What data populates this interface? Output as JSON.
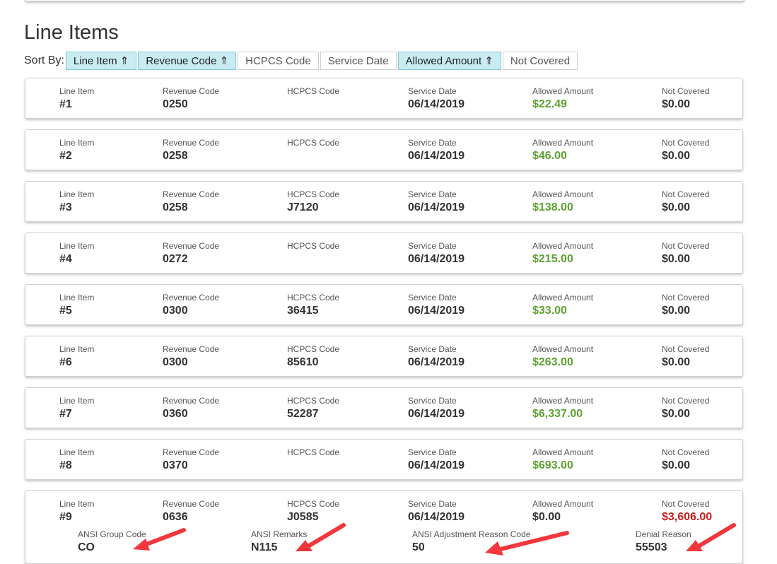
{
  "section_title": "Line Items",
  "sort": {
    "label": "Sort By:",
    "buttons": [
      {
        "label": "Line Item ⇑",
        "active": true
      },
      {
        "label": "Revenue Code ⇑",
        "active": true
      },
      {
        "label": "HCPCS Code",
        "active": false
      },
      {
        "label": "Service Date",
        "active": false
      },
      {
        "label": "Allowed Amount ⇑",
        "active": true
      },
      {
        "label": "Not Covered",
        "active": false
      }
    ]
  },
  "columns": {
    "line_item": "Line Item",
    "revenue_code": "Revenue Code",
    "hcpcs_code": "HCPCS Code",
    "service_date": "Service Date",
    "allowed_amount": "Allowed Amount",
    "not_covered": "Not Covered"
  },
  "colors": {
    "allowed": "#5ea332",
    "denied": "#c81d1d",
    "active_sort": "#c8ecf2",
    "arrow": "#f2373d"
  },
  "line_items": [
    {
      "line": "#1",
      "revenue": "0250",
      "hcpcs": "",
      "date": "06/14/2019",
      "allowed": "$22.49",
      "not_covered": "$0.00"
    },
    {
      "line": "#2",
      "revenue": "0258",
      "hcpcs": "",
      "date": "06/14/2019",
      "allowed": "$46.00",
      "not_covered": "$0.00"
    },
    {
      "line": "#3",
      "revenue": "0258",
      "hcpcs": "J7120",
      "date": "06/14/2019",
      "allowed": "$138.00",
      "not_covered": "$0.00"
    },
    {
      "line": "#4",
      "revenue": "0272",
      "hcpcs": "",
      "date": "06/14/2019",
      "allowed": "$215.00",
      "not_covered": "$0.00"
    },
    {
      "line": "#5",
      "revenue": "0300",
      "hcpcs": "36415",
      "date": "06/14/2019",
      "allowed": "$33.00",
      "not_covered": "$0.00"
    },
    {
      "line": "#6",
      "revenue": "0300",
      "hcpcs": "85610",
      "date": "06/14/2019",
      "allowed": "$263.00",
      "not_covered": "$0.00"
    },
    {
      "line": "#7",
      "revenue": "0360",
      "hcpcs": "52287",
      "date": "06/14/2019",
      "allowed": "$6,337.00",
      "not_covered": "$0.00"
    },
    {
      "line": "#8",
      "revenue": "0370",
      "hcpcs": "",
      "date": "06/14/2019",
      "allowed": "$693.00",
      "not_covered": "$0.00"
    },
    {
      "line": "#9",
      "revenue": "0636",
      "hcpcs": "J0585",
      "date": "06/14/2019",
      "allowed": "$0.00",
      "not_covered": "$3,606.00",
      "denial": {
        "ansi_group_code_label": "ANSI Group Code",
        "ansi_group_code": "CO",
        "ansi_remarks_label": "ANSI Remarks",
        "ansi_remarks": "N115",
        "ansi_adjustment_label": "ANSI Adjustment Reason Code",
        "ansi_adjustment": "50",
        "denial_reason_label": "Denial Reason",
        "denial_reason": "55503"
      }
    }
  ]
}
